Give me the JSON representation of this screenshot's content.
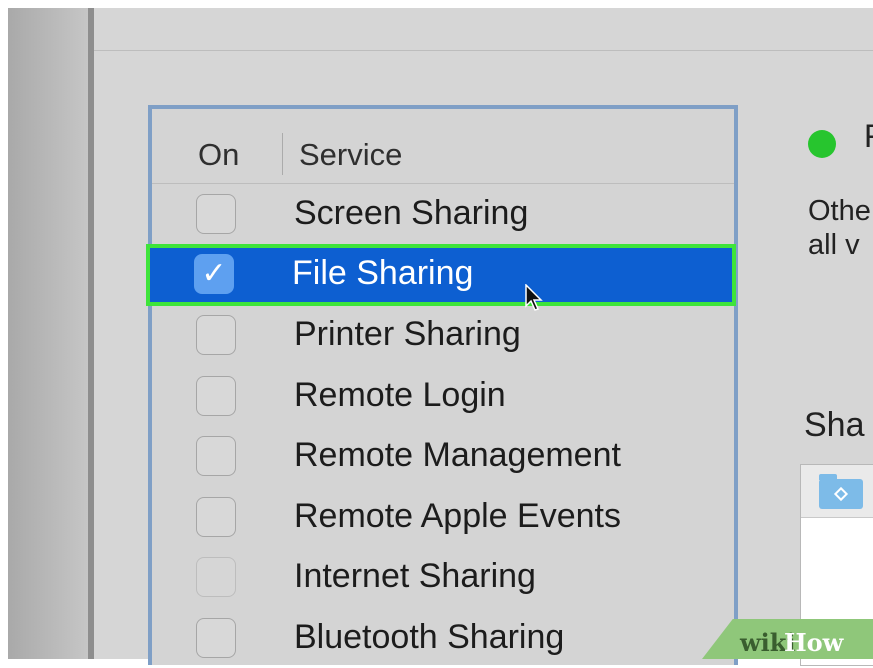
{
  "services_table": {
    "header_on": "On",
    "header_service": "Service",
    "rows": [
      {
        "label": "Screen Sharing",
        "checked": false,
        "selected": false,
        "faint": false
      },
      {
        "label": "File Sharing",
        "checked": true,
        "selected": true,
        "faint": false
      },
      {
        "label": "Printer Sharing",
        "checked": false,
        "selected": false,
        "faint": false
      },
      {
        "label": "Remote Login",
        "checked": false,
        "selected": false,
        "faint": false
      },
      {
        "label": "Remote Management",
        "checked": false,
        "selected": false,
        "faint": false
      },
      {
        "label": "Remote Apple Events",
        "checked": false,
        "selected": false,
        "faint": false
      },
      {
        "label": "Internet Sharing",
        "checked": false,
        "selected": false,
        "faint": true
      },
      {
        "label": "Bluetooth Sharing",
        "checked": false,
        "selected": false,
        "faint": false
      }
    ],
    "check_glyph": "✓"
  },
  "status": {
    "indicator_color": "#27c52e",
    "text_fragment": "F"
  },
  "description": {
    "line1": "Othe",
    "line2": "all v"
  },
  "shared_folders": {
    "title_fragment": "Sha",
    "folder_icon": "shared-folder-icon"
  },
  "watermark": {
    "part1": "wiki",
    "part2": "How"
  },
  "colors": {
    "selection": "#0d5fd1",
    "highlight_border": "#3ee43a",
    "panel_border": "#7f9fc6"
  }
}
